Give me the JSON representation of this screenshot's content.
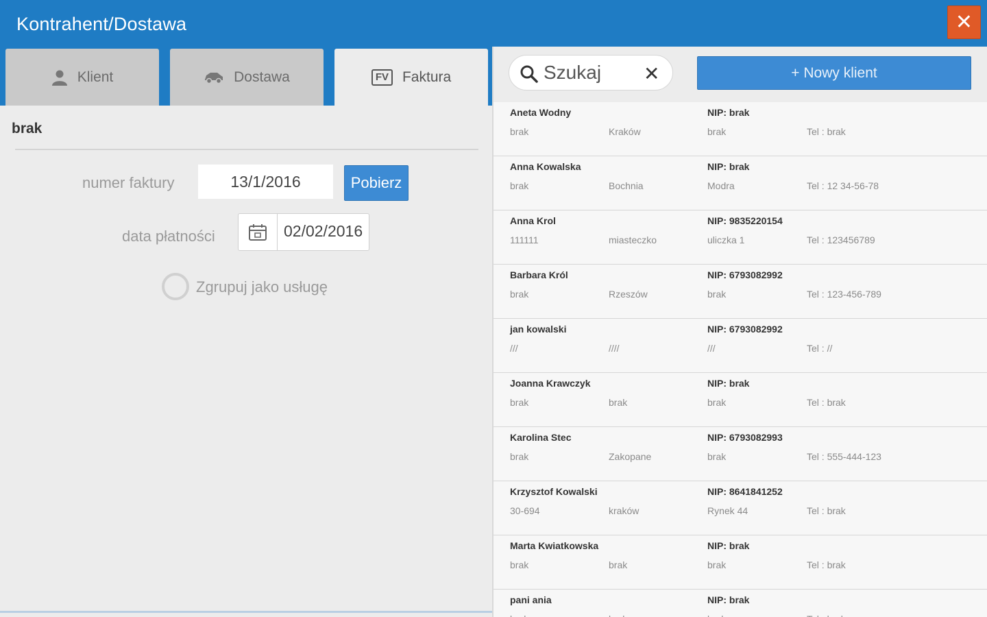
{
  "window": {
    "title": "Kontrahent/Dostawa",
    "close_label": "✕"
  },
  "tabs": [
    {
      "label": "Klient",
      "icon": "person-icon"
    },
    {
      "label": "Dostawa",
      "icon": "car-icon"
    },
    {
      "label": "Faktura",
      "icon": "invoice-icon",
      "icon_text": "FV",
      "active": true
    }
  ],
  "form": {
    "client_name": "brak",
    "invoice_number_label": "numer faktury",
    "invoice_number_value": "13/1/2016",
    "fetch_button_label": "Pobierz",
    "payment_date_label": "data płatności",
    "payment_date_value": "02/02/2016",
    "group_as_service_label": "Zgrupuj jako usługę",
    "group_as_service_checked": false
  },
  "search": {
    "placeholder": "Szukaj",
    "clear_label": "✕"
  },
  "new_client_button_label": "+ Nowy klient",
  "colors": {
    "titlebar": "#1f7cc4",
    "accent_button": "#3d8bd4",
    "close_button": "#e05a27"
  },
  "clients": [
    {
      "name": "Aneta Wodny",
      "nip": "NIP: brak",
      "code": "brak",
      "city": "Kraków",
      "street": "brak",
      "tel": "Tel : brak"
    },
    {
      "name": "Anna Kowalska",
      "nip": "NIP: brak",
      "code": "brak",
      "city": "Bochnia",
      "street": "Modra",
      "tel": "Tel : 12 34-56-78"
    },
    {
      "name": "Anna Krol",
      "nip": "NIP: 9835220154",
      "code": "111111",
      "city": "miasteczko",
      "street": "uliczka 1",
      "tel": "Tel : 123456789"
    },
    {
      "name": "Barbara Król",
      "nip": "NIP: 6793082992",
      "code": "brak",
      "city": "Rzeszów",
      "street": "brak",
      "tel": "Tel : 123-456-789"
    },
    {
      "name": "jan kowalski",
      "nip": "NIP: 6793082992",
      "code": "///",
      "city": "////",
      "street": "///",
      "tel": "Tel : //"
    },
    {
      "name": "Joanna Krawczyk",
      "nip": "NIP: brak",
      "code": "brak",
      "city": "brak",
      "street": "brak",
      "tel": "Tel : brak"
    },
    {
      "name": "Karolina Stec",
      "nip": "NIP: 6793082993",
      "code": "brak",
      "city": "Zakopane",
      "street": "brak",
      "tel": "Tel : 555-444-123"
    },
    {
      "name": "Krzysztof Kowalski",
      "nip": "NIP: 8641841252",
      "code": "30-694",
      "city": "kraków",
      "street": "Rynek 44",
      "tel": "Tel : brak"
    },
    {
      "name": "Marta Kwiatkowska",
      "nip": "NIP: brak",
      "code": "brak",
      "city": "brak",
      "street": "brak",
      "tel": "Tel : brak"
    },
    {
      "name": "pani ania",
      "nip": "NIP: brak",
      "code": "brak",
      "city": "brak",
      "street": "brak",
      "tel": "Tel : brak"
    }
  ]
}
